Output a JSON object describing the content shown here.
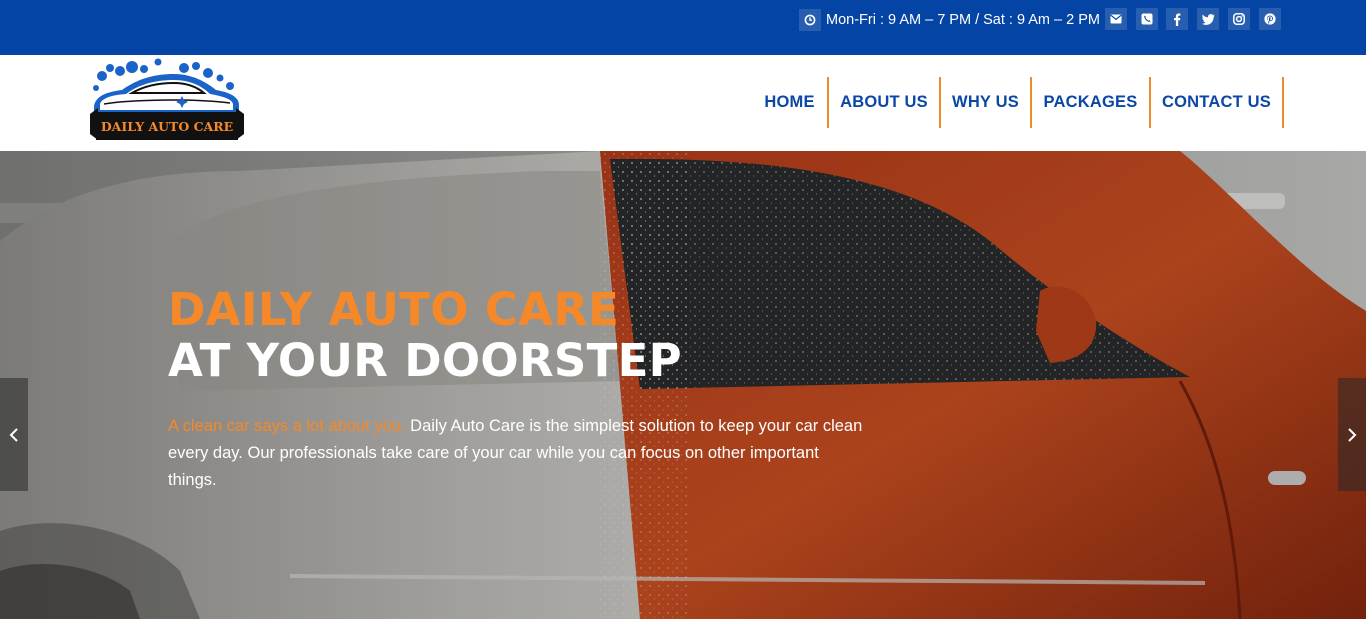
{
  "topbar": {
    "hours": "Mon-Fri : 9 AM – 7 PM / Sat : 9 Am – 2 PM",
    "icons": [
      "clock-icon",
      "envelope-icon",
      "phone-icon",
      "facebook-icon",
      "twitter-icon",
      "instagram-icon",
      "pinterest-icon"
    ]
  },
  "logo": {
    "text": "DAILY AUTO CARE"
  },
  "nav": {
    "items": [
      {
        "label": "HOME"
      },
      {
        "label": "ABOUT US"
      },
      {
        "label": "WHY US"
      },
      {
        "label": "PACKAGES"
      },
      {
        "label": "CONTACT US"
      }
    ]
  },
  "hero": {
    "title_line1": "DAILY AUTO CARE",
    "title_line2": "AT YOUR DOORSTEP",
    "text_accent": "A clean car says a lot about you.",
    "text_body": " Daily Auto Care is the simplest solution to keep your car clean every day. Our professionals take care of your car while you can focus on other important things.",
    "prev_icon": "chevron-left-icon",
    "next_icon": "chevron-right-icon"
  },
  "colors": {
    "primary_blue": "#0444a4",
    "nav_text": "#0b47a6",
    "accent_orange": "#f5892a",
    "white": "#ffffff"
  }
}
